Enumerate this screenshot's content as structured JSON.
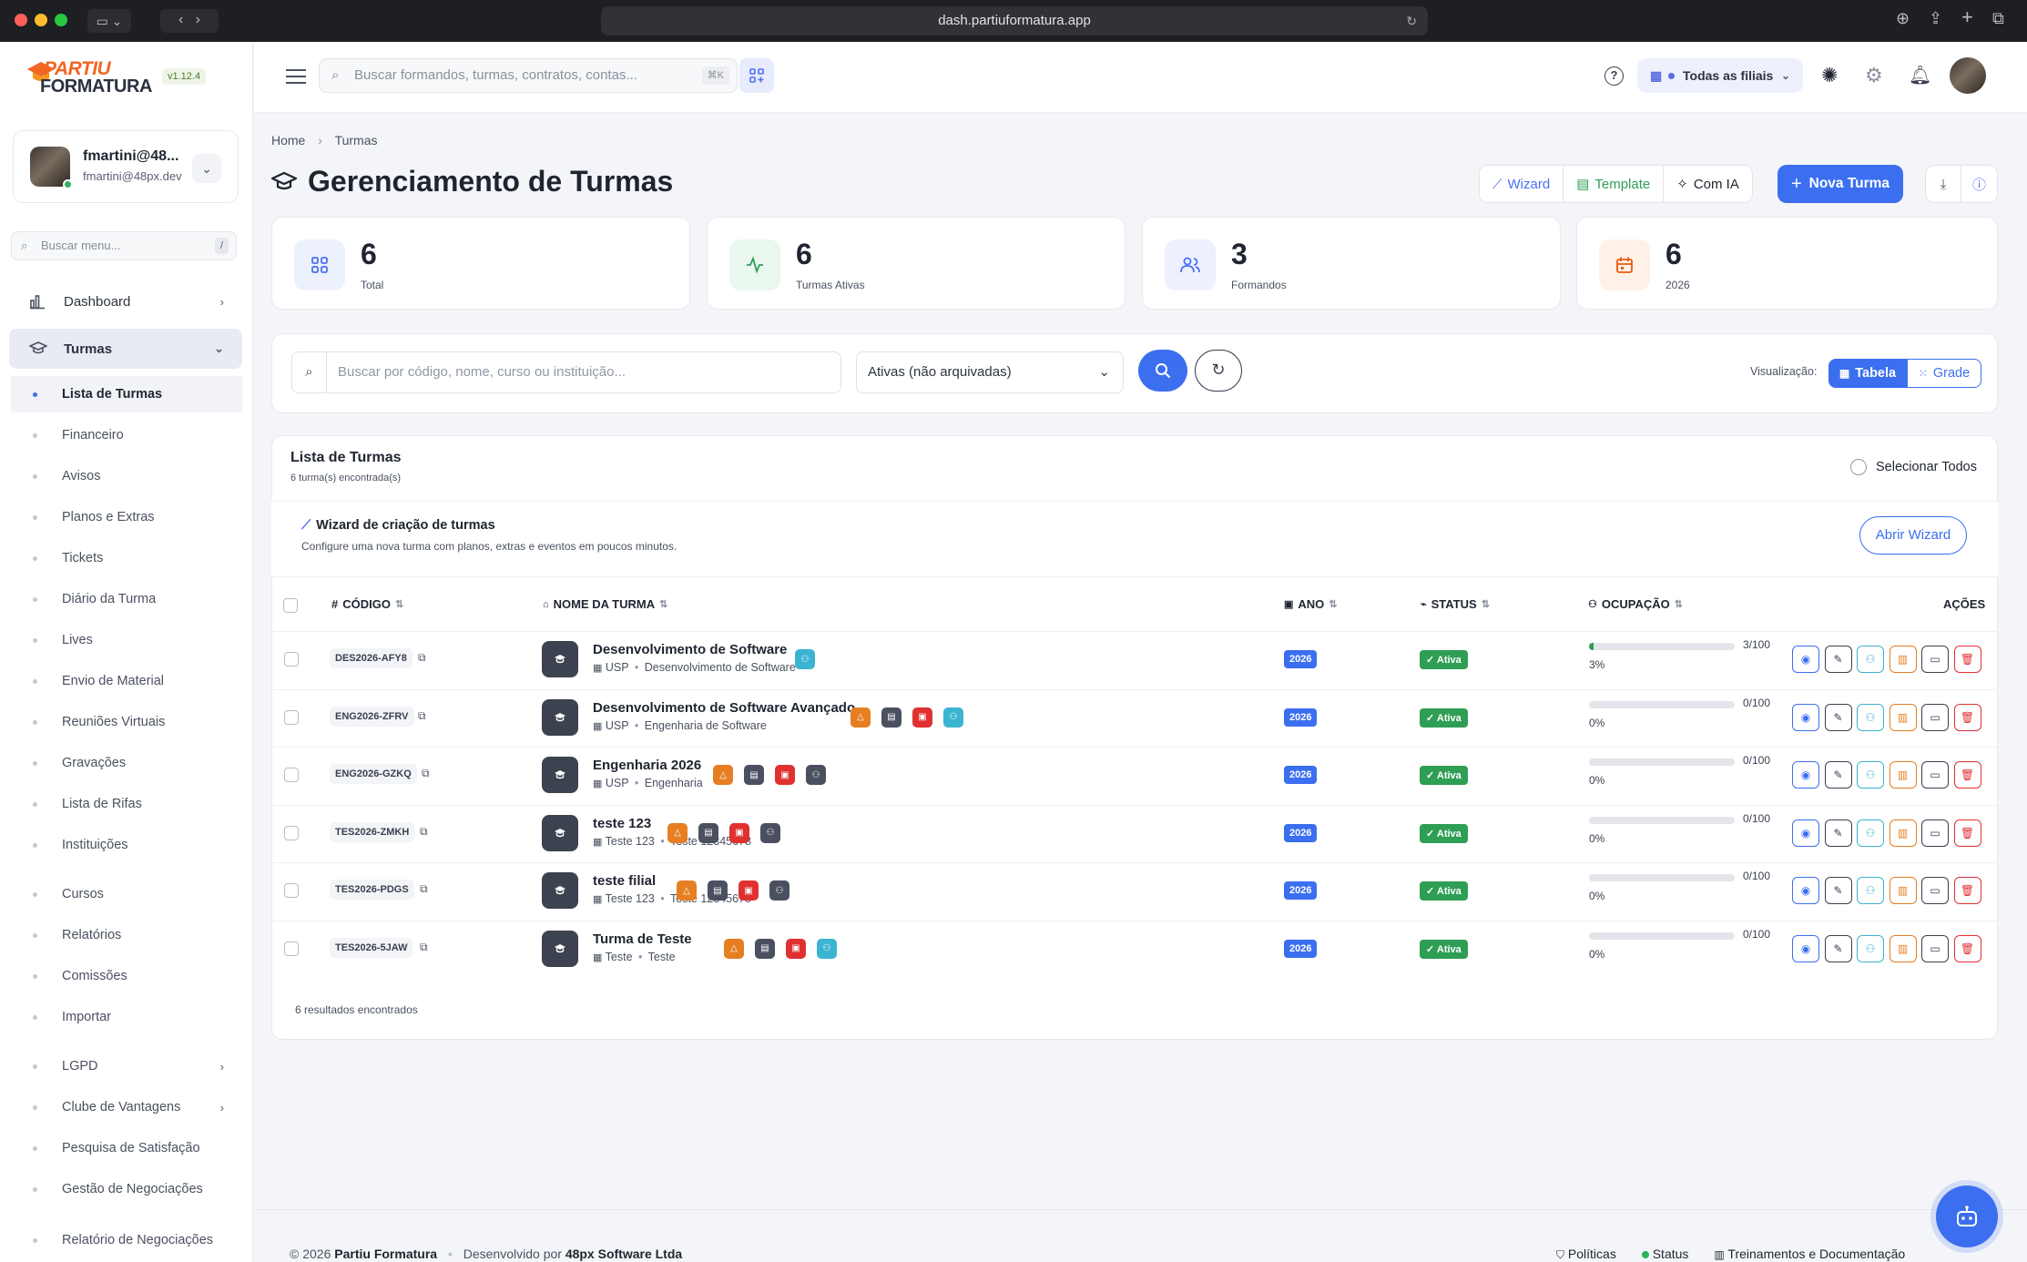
{
  "browser": {
    "url": "dash.partiuformatura.app"
  },
  "app": {
    "logo_top": "PARTIU",
    "logo_bottom": "FORMATURA",
    "version": "v1.12.4"
  },
  "user": {
    "name": "fmartini@48...",
    "email": "fmartini@48px.dev"
  },
  "sidebar": {
    "search_placeholder": "Buscar menu...",
    "search_kbd": "/",
    "items": [
      {
        "label": "Dashboard"
      },
      {
        "label": "Turmas"
      }
    ],
    "sub_items": [
      {
        "label": "Lista de Turmas"
      },
      {
        "label": "Financeiro"
      },
      {
        "label": "Avisos"
      },
      {
        "label": "Planos e Extras"
      },
      {
        "label": "Tickets"
      },
      {
        "label": "Diário da Turma"
      },
      {
        "label": "Lives"
      },
      {
        "label": "Envio de Material"
      },
      {
        "label": "Reuniões Virtuais"
      },
      {
        "label": "Gravações"
      },
      {
        "label": "Lista de Rifas"
      },
      {
        "label": "Instituições"
      }
    ],
    "more_items": [
      {
        "label": "Cursos"
      },
      {
        "label": "Relatórios"
      },
      {
        "label": "Comissões"
      },
      {
        "label": "Importar"
      },
      {
        "label": "LGPD"
      },
      {
        "label": "Clube de Vantagens"
      },
      {
        "label": "Pesquisa de Satisfação"
      },
      {
        "label": "Gestão de Negociações"
      },
      {
        "label": "Relatório de Negociações"
      }
    ]
  },
  "topbar": {
    "search_placeholder": "Buscar formandos, turmas, contratos, contas...",
    "search_kbd": "⌘K",
    "filial": "Todas as filiais"
  },
  "breadcrumb": {
    "home": "Home",
    "current": "Turmas"
  },
  "page": {
    "title": "Gerenciamento de Turmas"
  },
  "actions": {
    "wizard": "Wizard",
    "template": "Template",
    "ai": "Com IA",
    "new": "Nova Turma"
  },
  "stats": [
    {
      "value": "6",
      "label": "Total",
      "icon": "grid-icon",
      "color": "#4c6ef5",
      "bg": "#edf1fe"
    },
    {
      "value": "6",
      "label": "Turmas Ativas",
      "icon": "activity-icon",
      "color": "#2f9e55",
      "bg": "#eaf7ef"
    },
    {
      "value": "3",
      "label": "Formandos",
      "icon": "users-icon",
      "color": "#4c6ef5",
      "bg": "#edf1fe"
    },
    {
      "value": "6",
      "label": "2026",
      "icon": "calendar-icon",
      "color": "#e8590c",
      "bg": "#fff1e8"
    }
  ],
  "filters": {
    "search_placeholder": "Buscar por código, nome, curso ou instituição...",
    "status_value": "Ativas (não arquivadas)",
    "view_label": "Visualização:",
    "view_table": "Tabela",
    "view_grid": "Grade"
  },
  "list": {
    "title": "Lista de Turmas",
    "count": "6 turma(s) encontrada(s)",
    "select_all": "Selecionar Todos",
    "wizard_title": "Wizard de criação de turmas",
    "wizard_desc": "Configure uma nova turma com planos, extras e eventos em poucos minutos.",
    "wizard_button": "Abrir Wizard",
    "columns": {
      "code": "CÓDIGO",
      "name": "NOME DA TURMA",
      "year": "ANO",
      "status": "STATUS",
      "occupancy": "OCUPAÇÃO",
      "actions": "AÇÕES"
    },
    "footer": "6 resultados encontrados"
  },
  "rows": [
    {
      "code": "DES2026-AFY8",
      "name": "Desenvolvimento de Software",
      "inst": "USP",
      "course": "Desenvolvimento de Software",
      "chips": [
        "teal"
      ],
      "year": "2026",
      "status": "Ativa",
      "occ": "3/100",
      "pct": "3%",
      "fill": 0.03
    },
    {
      "code": "ENG2026-ZFRV",
      "name": "Desenvolvimento de Software Avançado",
      "inst": "USP",
      "course": "Engenharia de Software",
      "chips": [
        "orange",
        "gray",
        "red",
        "teal"
      ],
      "year": "2026",
      "status": "Ativa",
      "occ": "0/100",
      "pct": "0%",
      "fill": 0
    },
    {
      "code": "ENG2026-GZKQ",
      "name": "Engenharia 2026",
      "inst": "USP",
      "course": "Engenharia",
      "chips": [
        "orange",
        "gray",
        "red",
        "dark"
      ],
      "year": "2026",
      "status": "Ativa",
      "occ": "0/100",
      "pct": "0%",
      "fill": 0
    },
    {
      "code": "TES2026-ZMKH",
      "name": "teste 123",
      "inst": "Teste 123",
      "course": "Teste 12345678",
      "chips": [
        "orange",
        "gray",
        "red",
        "dark"
      ],
      "year": "2026",
      "status": "Ativa",
      "occ": "0/100",
      "pct": "0%",
      "fill": 0
    },
    {
      "code": "TES2026-PDGS",
      "name": "teste filial",
      "inst": "Teste 123",
      "course": "Teste 12345678",
      "chips": [
        "orange",
        "gray",
        "red",
        "dark"
      ],
      "year": "2026",
      "status": "Ativa",
      "occ": "0/100",
      "pct": "0%",
      "fill": 0
    },
    {
      "code": "TES2026-5JAW",
      "name": "Turma de Teste",
      "inst": "Teste",
      "course": "Teste",
      "chips": [
        "orange",
        "gray",
        "red",
        "teal"
      ],
      "year": "2026",
      "status": "Ativa",
      "occ": "0/100",
      "pct": "0%",
      "fill": 0
    }
  ],
  "footer": {
    "copyright": "© 2026",
    "brand": "Partiu Formatura",
    "dev_prefix": "Desenvolvido por",
    "dev": "48px Software Ltda",
    "policies": "Políticas",
    "status": "Status",
    "training": "Treinamentos e Documentação"
  }
}
